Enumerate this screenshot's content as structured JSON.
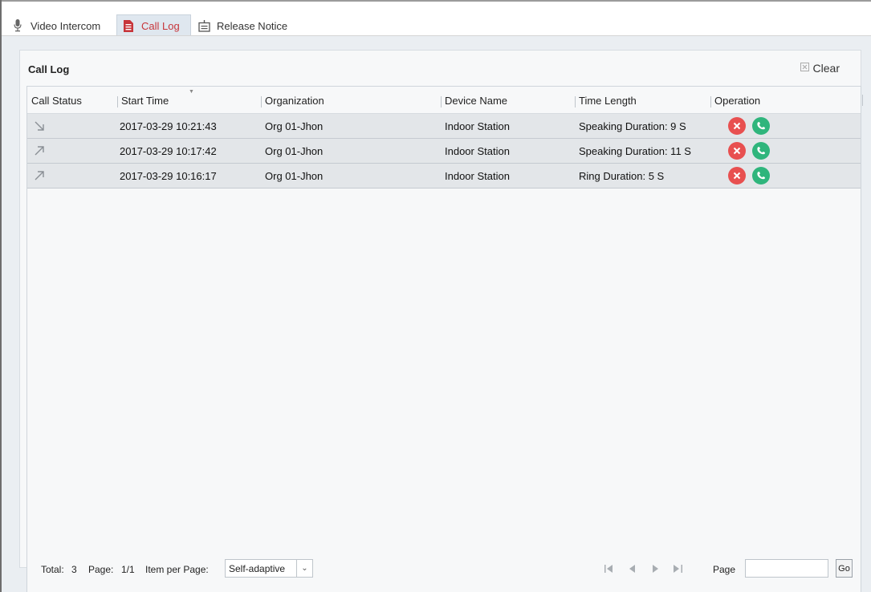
{
  "tabs": [
    {
      "label": "Video Intercom",
      "icon": "microphone-icon",
      "active": false
    },
    {
      "label": "Call Log",
      "icon": "document-icon",
      "active": true
    },
    {
      "label": "Release Notice",
      "icon": "notice-board-icon",
      "active": false
    }
  ],
  "panel": {
    "title": "Call Log",
    "clear_label": "Clear"
  },
  "table": {
    "columns": [
      "Call Status",
      "Start Time",
      "Organization",
      "Device Name",
      "Time Length",
      "Operation"
    ],
    "rows": [
      {
        "status": "incoming",
        "start_time": "2017-03-29 10:21:43",
        "organization": "Org 01-Jhon",
        "device": "Indoor Station",
        "length": "Speaking Duration: 9 S"
      },
      {
        "status": "outgoing",
        "start_time": "2017-03-29 10:17:42",
        "organization": "Org 01-Jhon",
        "device": "Indoor Station",
        "length": "Speaking Duration: 11 S"
      },
      {
        "status": "outgoing",
        "start_time": "2017-03-29 10:16:17",
        "organization": "Org 01-Jhon",
        "device": "Indoor Station",
        "length": "Ring Duration: 5 S"
      }
    ]
  },
  "footer": {
    "total_label": "Total:",
    "total_value": "3",
    "page_label": "Page:",
    "page_value": "1/1",
    "per_page_label": "Item per Page:",
    "per_page_value": "Self-adaptive",
    "goto_label": "Page",
    "goto_value": "",
    "go_label": "Go"
  },
  "colors": {
    "active_tab_text": "#c7353a",
    "delete_button": "#e85050",
    "call_button": "#2fb57c"
  }
}
